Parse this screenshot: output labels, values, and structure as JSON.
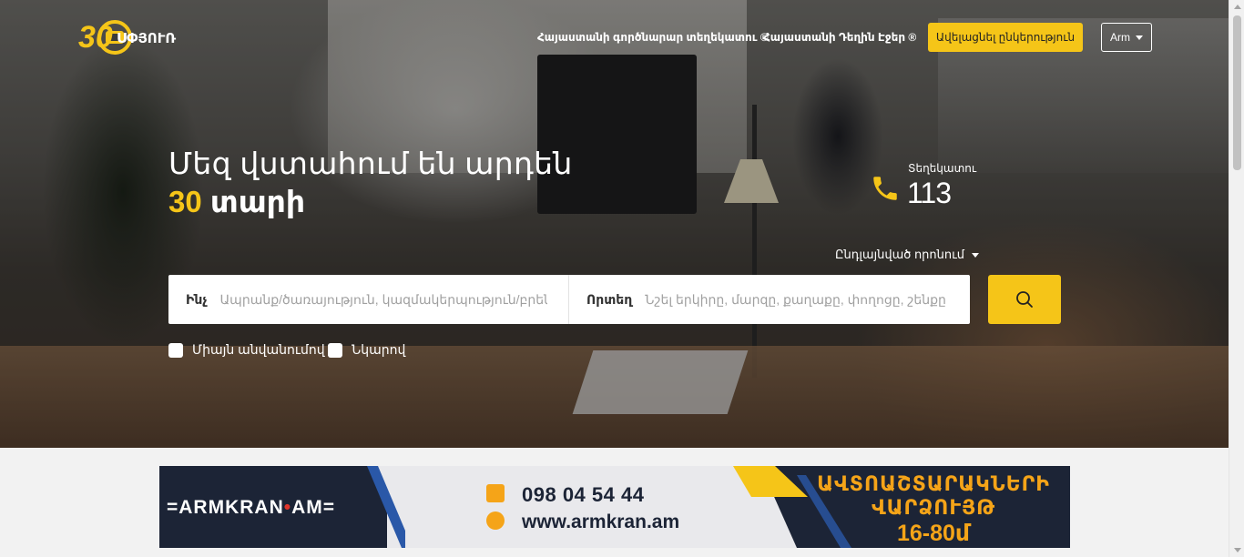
{
  "header": {
    "logo_text": "ՍՓՅՈՒՌ",
    "logo_anniversary": "30",
    "nav": [
      {
        "label": "Հայաստանի գործնարար տեղեկատու ®"
      },
      {
        "label": "Հայաստանի Դեղին Էջեր ®"
      }
    ],
    "add_company_label": "Ավելացնել ընկերություն",
    "language": "Arm"
  },
  "hero": {
    "headline_line1": "Մեզ վստահում են արդեն",
    "headline_number": "30",
    "headline_word": "տարի",
    "reference_label": "Տեղեկատու",
    "reference_number": "113",
    "advanced_search_label": "Ընդլայնված որոնում"
  },
  "search": {
    "what_label": "Ինչ",
    "what_placeholder": "Ապրանք/ծառայություն, կազմակերպություն/բրեն",
    "where_label": "Որտեղ",
    "where_placeholder": "Նշել երկիրը, մարզը, քաղաքը, փողոցը, շենքը",
    "options": [
      {
        "label": "Միայն անվանումով",
        "checked": false
      },
      {
        "label": "Նկարով",
        "checked": false
      }
    ]
  },
  "banner": {
    "brand": "ARMKRAN",
    "brand_sep": "•",
    "brand_tld": "AM",
    "phone": "098 04 54 44",
    "site": "www.armkran.am",
    "right_line1": "ԱՎՏՈԱՇՏԱՐԱԿՆԵՐԻ",
    "right_line2": "ՎԱՐՁՈՒՅԹ",
    "right_line3": "16-80մ"
  },
  "colors": {
    "accent": "#f5c518",
    "banner_dark": "#1c2436",
    "banner_orange": "#f5a418"
  }
}
